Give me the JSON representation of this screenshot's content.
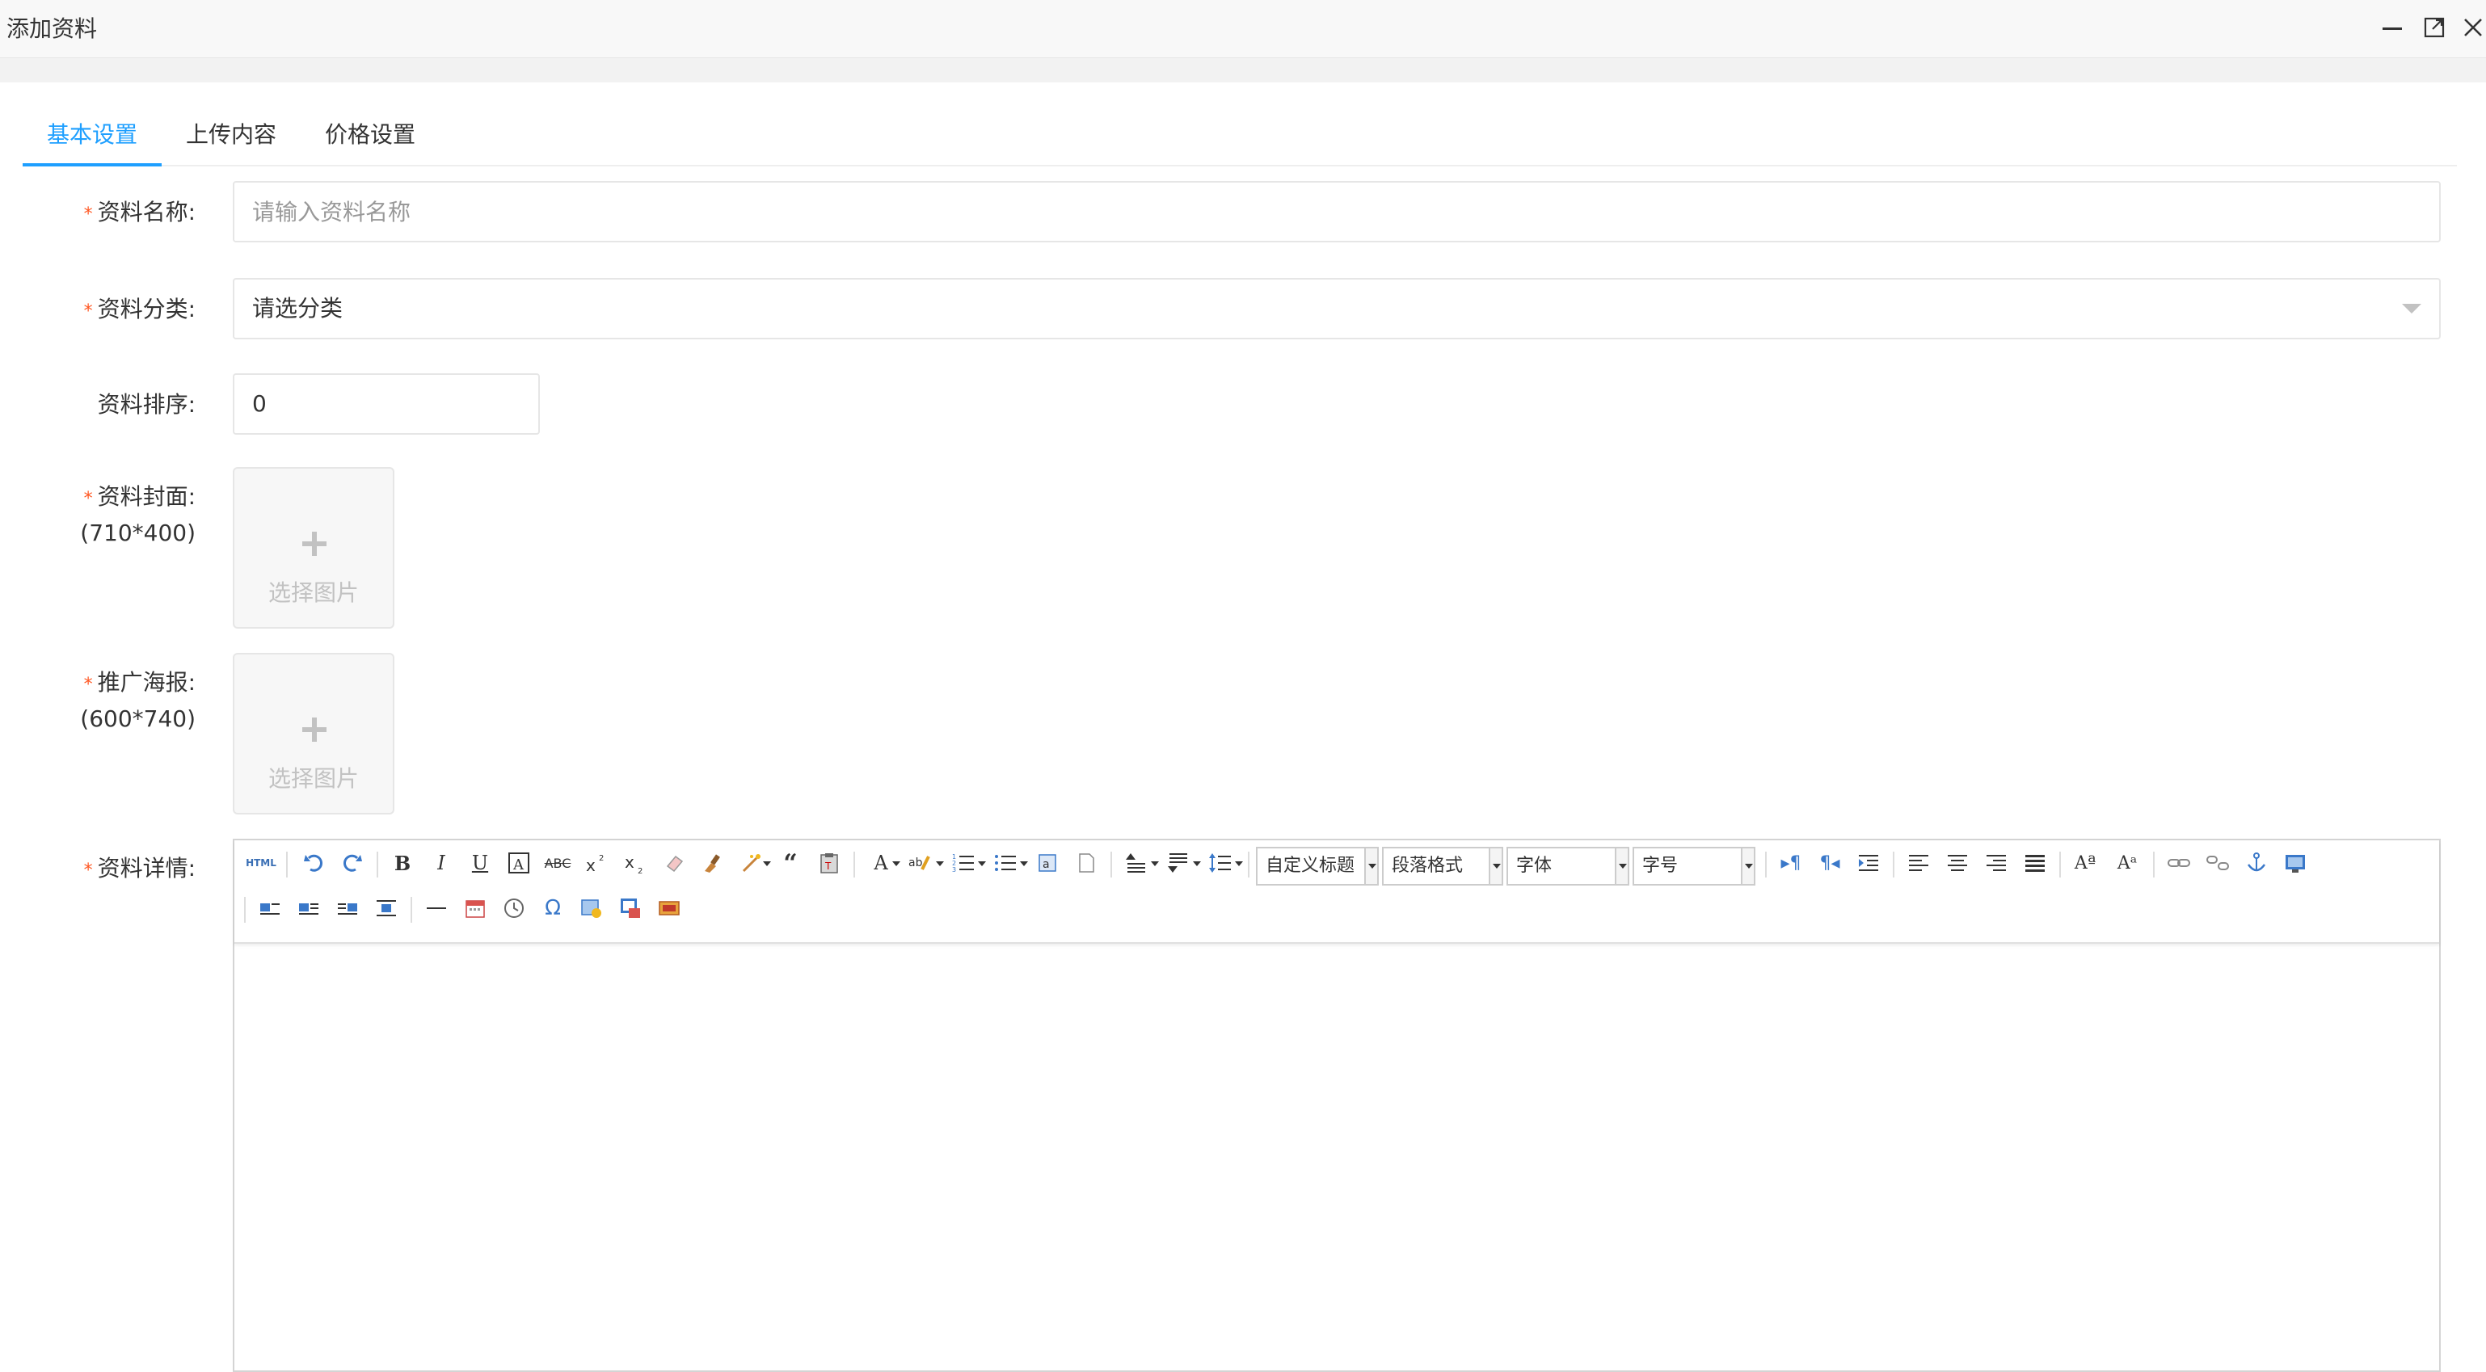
{
  "window": {
    "title": "添加资料",
    "controls": [
      "minimize-icon",
      "maximize-icon",
      "close-icon"
    ]
  },
  "tabs": [
    {
      "label": "基本设置",
      "active": true
    },
    {
      "label": "上传内容",
      "active": false
    },
    {
      "label": "价格设置",
      "active": false
    }
  ],
  "form": {
    "name": {
      "label": "资料名称:",
      "required_mark": "*",
      "value": "",
      "placeholder": "请输入资料名称"
    },
    "category": {
      "label": "资料分类:",
      "required_mark": "*",
      "selected": "请选分类"
    },
    "sort": {
      "label": "资料排序:",
      "value": "0"
    },
    "cover": {
      "label": "资料封面:",
      "sublabel": "(710*400)",
      "required_mark": "*",
      "upload_text": "选择图片"
    },
    "poster": {
      "label": "推广海报:",
      "sublabel": "(600*740)",
      "required_mark": "*",
      "upload_text": "选择图片"
    },
    "detail": {
      "label": "资料详情:",
      "required_mark": "*"
    }
  },
  "editor": {
    "html_button": "HTML",
    "dropdowns": {
      "title": "自定义标题",
      "paragraph": "段落格式",
      "font_family": "字体",
      "font_size": "字号"
    },
    "row1_icons": [
      "source-html-icon",
      "undo-icon",
      "redo-icon",
      "bold-icon",
      "italic-icon",
      "underline-icon",
      "font-border-icon",
      "strikethrough-icon",
      "superscript-icon",
      "subscript-icon",
      "eraser-icon",
      "format-brush-icon",
      "auto-format-icon",
      "blockquote-icon",
      "paste-plain-icon",
      "font-color-icon",
      "highlight-color-icon",
      "ordered-list-icon",
      "unordered-list-icon",
      "select-all-icon",
      "clear-doc-icon",
      "row-spacing-top-icon",
      "row-spacing-bottom-icon",
      "line-height-icon",
      "ltr-icon",
      "rtl-icon",
      "indent-icon",
      "align-left-icon",
      "align-center-icon",
      "align-right-icon",
      "align-justify-icon",
      "uppercase-icon",
      "lowercase-icon",
      "link-icon",
      "unlink-icon",
      "anchor-icon",
      "image-float-none-icon"
    ],
    "row2_icons": [
      "image-none-icon",
      "image-left-icon",
      "image-right-icon",
      "image-center-icon",
      "horizontal-rule-icon",
      "date-icon",
      "time-icon",
      "special-chars-icon",
      "insert-image-icon",
      "word-image-icon",
      "scrawl-icon"
    ]
  },
  "colors": {
    "accent": "#1e9fff",
    "required": "#ff5722",
    "border": "#e6e6e6",
    "placeholder": "#999999"
  }
}
